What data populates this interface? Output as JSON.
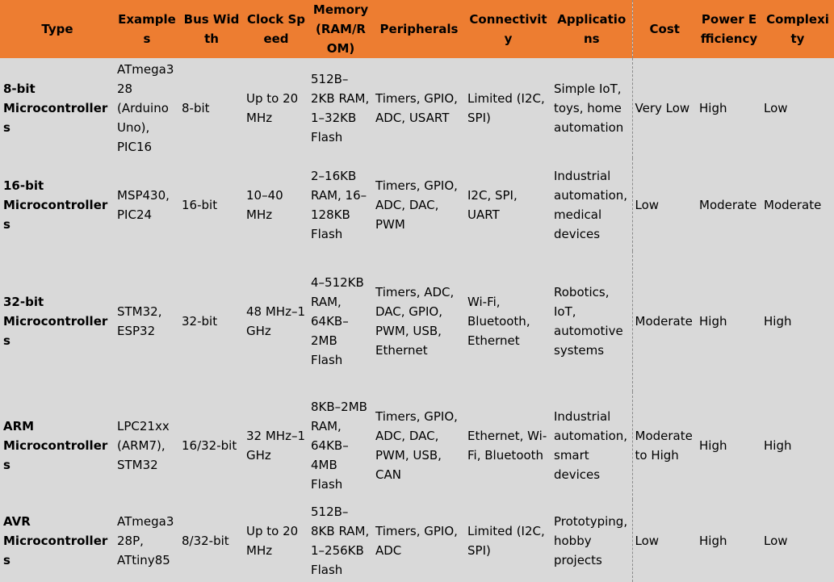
{
  "headers": [
    "Type",
    "Examples",
    "Bus Width",
    "Clock Speed",
    "Memory (RAM/ROM)",
    "Peripherals",
    "Connectivity",
    "Applications",
    "Cost",
    "Power Efficiency",
    "Complexity"
  ],
  "rows": [
    [
      "8-bit Microcontrollers",
      "ATmega328 (Arduino Uno), PIC16",
      "8-bit",
      "Up to 20 MHz",
      "512B–2KB RAM, 1–32KB Flash",
      "Timers, GPIO, ADC, USART",
      "Limited (I2C, SPI)",
      "Simple IoT, toys, home automation",
      "Very Low",
      "High",
      "Low"
    ],
    [
      "16-bit Microcontrollers",
      "MSP430, PIC24",
      "16-bit",
      "10–40 MHz",
      "2–16KB RAM, 16–128KB Flash",
      "Timers, GPIO, ADC, DAC, PWM",
      "I2C, SPI, UART",
      "Industrial automation, medical devices",
      "Low",
      "Moderate",
      "Moderate"
    ],
    [
      "32-bit Microcontrollers",
      "STM32, ESP32",
      "32-bit",
      "48 MHz–1 GHz",
      "4–512KB RAM, 64KB–2MB Flash",
      "Timers, ADC, DAC, GPIO, PWM, USB, Ethernet",
      "Wi-Fi, Bluetooth, Ethernet",
      "Robotics, IoT, automotive systems",
      "Moderate",
      "High",
      "High"
    ],
    [
      "ARM Microcontrollers",
      "LPC21xx (ARM7), STM32",
      "16/32-bit",
      "32 MHz–1 GHz",
      "8KB–2MB RAM, 64KB–4MB Flash",
      "Timers, GPIO, ADC, DAC, PWM, USB, CAN",
      "Ethernet, Wi-Fi, Bluetooth",
      "Industrial automation, smart devices",
      "Moderate to High",
      "High",
      "High"
    ],
    [
      "AVR Microcontrollers",
      "ATmega328P, ATtiny85",
      "8/32-bit",
      "Up to 20 MHz",
      "512B–8KB RAM, 1–256KB Flash",
      "Timers, GPIO, ADC",
      "Limited (I2C, SPI)",
      "Prototyping, hobby projects",
      "Low",
      "High",
      "Low"
    ]
  ]
}
